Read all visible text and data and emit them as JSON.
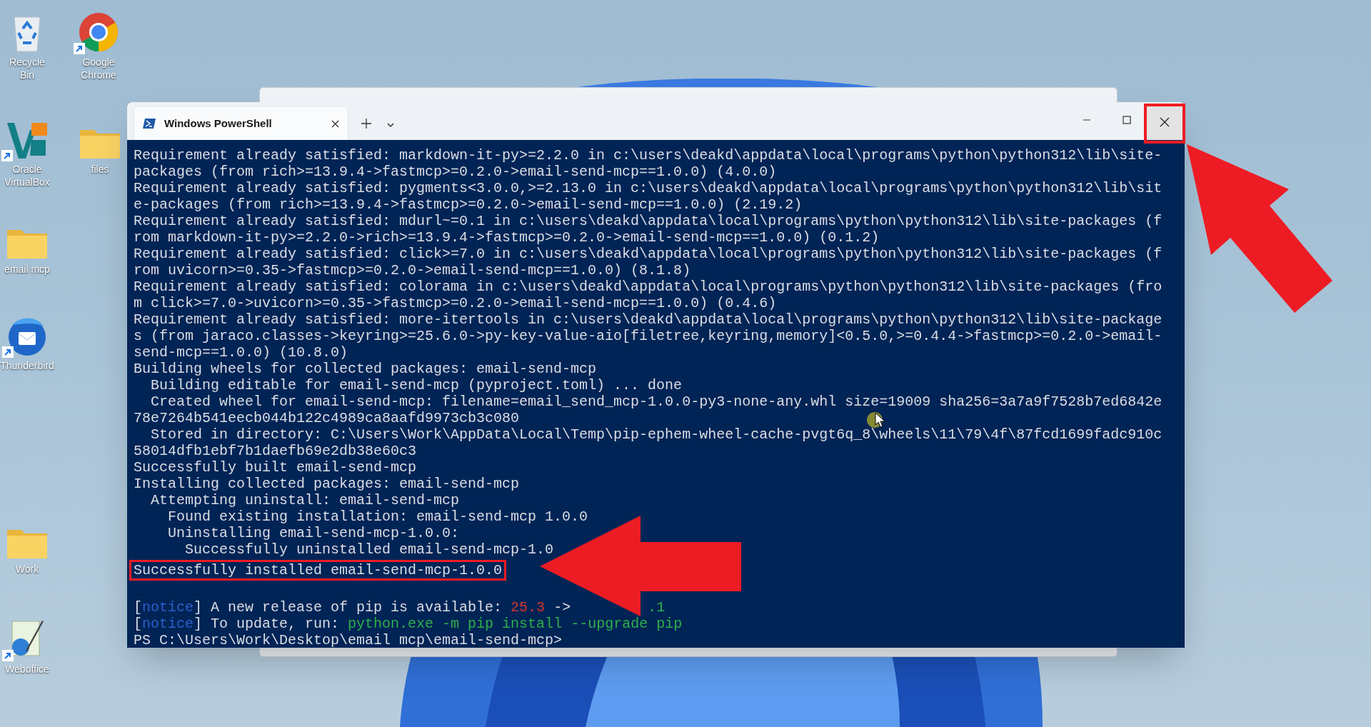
{
  "desktop_icons": [
    {
      "label": "Recycle Bin",
      "kind": "bin",
      "shortcut": false
    },
    {
      "label": "Google Chrome",
      "kind": "browser",
      "shortcut": true
    },
    {
      "label": "Oracle VirtualBox",
      "kind": "vm",
      "shortcut": true
    },
    {
      "label": "files",
      "kind": "folder",
      "shortcut": false
    },
    {
      "label": "email mcp",
      "kind": "folder",
      "shortcut": false
    },
    {
      "label": "Thunderbird",
      "kind": "mail",
      "shortcut": true
    },
    {
      "label": "Work",
      "kind": "folder",
      "shortcut": false
    },
    {
      "label": "Weboffice",
      "kind": "editor",
      "shortcut": true
    }
  ],
  "terminal": {
    "tab": {
      "title": "Windows PowerShell",
      "selected": true
    },
    "lines": [
      {
        "kind": "text",
        "segments": [
          {
            "kind": "plain",
            "text": "Requirement already satisfied: markdown-it-py>=2.2.0 in c:\\users\\deakd\\appdata\\local\\programs\\python\\python312\\lib\\site-"
          }
        ]
      },
      {
        "kind": "text",
        "segments": [
          {
            "kind": "plain",
            "text": "packages (from rich>=13.9.4->fastmcp>=0.2.0->email-send-mcp==1.0.0) (4.0.0)"
          }
        ]
      },
      {
        "kind": "text",
        "segments": [
          {
            "kind": "plain",
            "text": "Requirement already satisfied: pygments<3.0.0,>=2.13.0 in c:\\users\\deakd\\appdata\\local\\programs\\python\\python312\\lib\\sit"
          }
        ]
      },
      {
        "kind": "text",
        "segments": [
          {
            "kind": "plain",
            "text": "e-packages (from rich>=13.9.4->fastmcp>=0.2.0->email-send-mcp==1.0.0) (2.19.2)"
          }
        ]
      },
      {
        "kind": "text",
        "segments": [
          {
            "kind": "plain",
            "text": "Requirement already satisfied: mdurl~=0.1 in c:\\users\\deakd\\appdata\\local\\programs\\python\\python312\\lib\\site-packages (f"
          }
        ]
      },
      {
        "kind": "text",
        "segments": [
          {
            "kind": "plain",
            "text": "rom markdown-it-py>=2.2.0->rich>=13.9.4->fastmcp>=0.2.0->email-send-mcp==1.0.0) (0.1.2)"
          }
        ]
      },
      {
        "kind": "text",
        "segments": [
          {
            "kind": "plain",
            "text": "Requirement already satisfied: click>=7.0 in c:\\users\\deakd\\appdata\\local\\programs\\python\\python312\\lib\\site-packages (f"
          }
        ]
      },
      {
        "kind": "text",
        "segments": [
          {
            "kind": "plain",
            "text": "rom uvicorn>=0.35->fastmcp>=0.2.0->email-send-mcp==1.0.0) (8.1.8)"
          }
        ]
      },
      {
        "kind": "text",
        "segments": [
          {
            "kind": "plain",
            "text": "Requirement already satisfied: colorama in c:\\users\\deakd\\appdata\\local\\programs\\python\\python312\\lib\\site-packages (fro"
          }
        ]
      },
      {
        "kind": "text",
        "segments": [
          {
            "kind": "plain",
            "text": "m click>=7.0->uvicorn>=0.35->fastmcp>=0.2.0->email-send-mcp==1.0.0) (0.4.6)"
          }
        ]
      },
      {
        "kind": "text",
        "segments": [
          {
            "kind": "plain",
            "text": "Requirement already satisfied: more-itertools in c:\\users\\deakd\\appdata\\local\\programs\\python\\python312\\lib\\site-package"
          }
        ]
      },
      {
        "kind": "text",
        "segments": [
          {
            "kind": "plain",
            "text": "s (from jaraco.classes->keyring>=25.6.0->py-key-value-aio[filetree,keyring,memory]<0.5.0,>=0.4.4->fastmcp>=0.2.0->email-"
          }
        ]
      },
      {
        "kind": "text",
        "segments": [
          {
            "kind": "plain",
            "text": "send-mcp==1.0.0) (10.8.0)"
          }
        ]
      },
      {
        "kind": "text",
        "segments": [
          {
            "kind": "plain",
            "text": "Building wheels for collected packages: email-send-mcp"
          }
        ]
      },
      {
        "kind": "text",
        "segments": [
          {
            "kind": "plain",
            "text": "  Building editable for email-send-mcp (pyproject.toml) ... done"
          }
        ]
      },
      {
        "kind": "text",
        "segments": [
          {
            "kind": "plain",
            "text": "  Created wheel for email-send-mcp: filename=email_send_mcp-1.0.0-py3-none-any.whl size=19009 sha256=3a7a9f7528b7ed6842e"
          }
        ]
      },
      {
        "kind": "text",
        "segments": [
          {
            "kind": "plain",
            "text": "78e7264b541eecb044b122c4989ca8aafd9973cb3c080"
          }
        ]
      },
      {
        "kind": "text",
        "segments": [
          {
            "kind": "plain",
            "text": "  Stored in directory: C:\\Users\\Work\\AppData\\Local\\Temp\\pip-ephem-wheel-cache-pvgt6q_8\\wheels\\11\\79\\4f\\87fcd1699fadc910c"
          }
        ]
      },
      {
        "kind": "text",
        "segments": [
          {
            "kind": "plain",
            "text": "58014dfb1ebf7b1daefb69e2db38e60c3"
          }
        ]
      },
      {
        "kind": "text",
        "segments": [
          {
            "kind": "plain",
            "text": "Successfully built email-send-mcp"
          }
        ]
      },
      {
        "kind": "text",
        "segments": [
          {
            "kind": "plain",
            "text": "Installing collected packages: email-send-mcp"
          }
        ]
      },
      {
        "kind": "text",
        "segments": [
          {
            "kind": "plain",
            "text": "  Attempting uninstall: email-send-mcp"
          }
        ]
      },
      {
        "kind": "text",
        "segments": [
          {
            "kind": "plain",
            "text": "    Found existing installation: email-send-mcp 1.0.0"
          }
        ]
      },
      {
        "kind": "text",
        "segments": [
          {
            "kind": "plain",
            "text": "    Uninstalling email-send-mcp-1.0.0:"
          }
        ]
      },
      {
        "kind": "text",
        "segments": [
          {
            "kind": "plain",
            "text": "      Successfully uninstalled email-send-mcp-1.0"
          }
        ]
      },
      {
        "kind": "boxed",
        "segments": [
          {
            "kind": "plain",
            "text": "Successfully installed email-send-mcp-1.0.0"
          }
        ]
      },
      {
        "kind": "blank"
      },
      {
        "kind": "text",
        "segments": [
          {
            "kind": "plain",
            "text": "["
          },
          {
            "kind": "notice",
            "text": "notice"
          },
          {
            "kind": "plain",
            "text": "] A new release of pip is available:"
          },
          {
            "kind": "old-version",
            "text": "25.3"
          },
          {
            "kind": "plain",
            "text": "->"
          },
          {
            "kind": "new-version",
            "text": ".1"
          }
        ]
      },
      {
        "kind": "text",
        "segments": [
          {
            "kind": "plain",
            "text": "["
          },
          {
            "kind": "notice",
            "text": "notice"
          },
          {
            "kind": "plain",
            "text": "] To update, run:"
          },
          {
            "kind": "command",
            "text": "python.exe -m pip install --upgrade pip"
          }
        ]
      },
      {
        "kind": "text",
        "segments": [
          {
            "kind": "plain",
            "text": "PS C:\\Users\\Work\\Desktop\\email mcp\\email-send-mcp>"
          }
        ]
      }
    ]
  }
}
